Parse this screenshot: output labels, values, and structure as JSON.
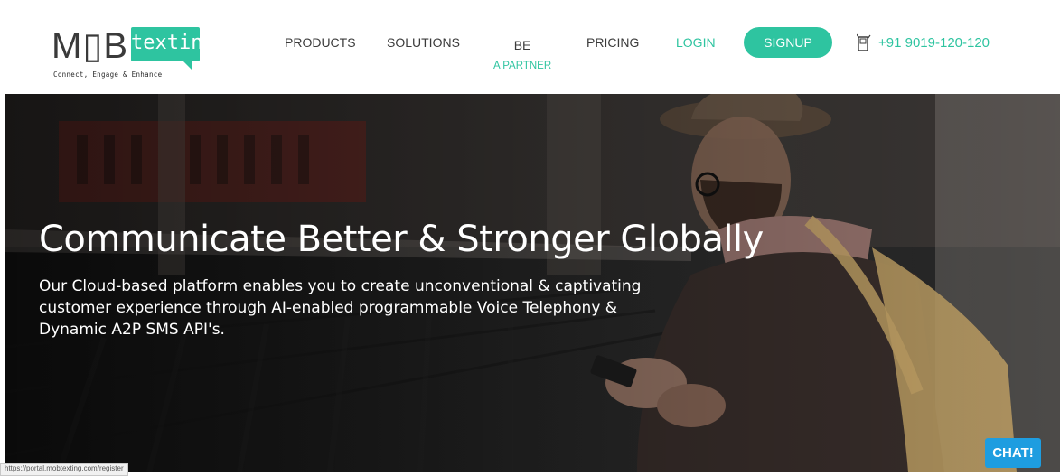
{
  "brand": {
    "logo_left": "M▯B",
    "logo_right": "texting",
    "tagline": "Connect, Engage & Enhance",
    "accent_color": "#2ec4a0"
  },
  "nav": {
    "products": "PRODUCTS",
    "solutions": "SOLUTIONS",
    "partner_line1": "BE",
    "partner_line2": "A PARTNER",
    "pricing": "PRICING",
    "login": "LOGIN",
    "signup": "SIGNUP",
    "phone_icon": "phone-icon",
    "phone": "+91 9019-120-120"
  },
  "hero": {
    "title": "Communicate Better & Stronger Globally",
    "description": "Our Cloud-based platform enables you to create unconventional & captivating customer experience through AI-enabled programmable Voice Telephony & Dynamic A2P SMS API's."
  },
  "chat": {
    "label": "CHAT!",
    "color": "#1e9de0"
  },
  "status_bar": {
    "url": "https://portal.mobtexting.com/register"
  }
}
